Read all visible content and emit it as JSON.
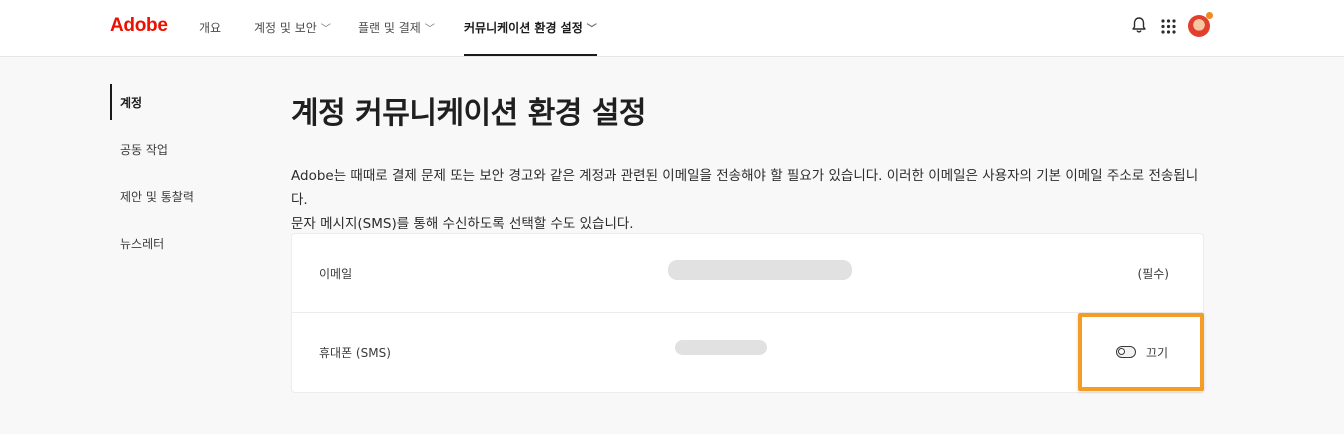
{
  "header": {
    "logo": "Adobe",
    "nav": [
      {
        "label": "개요"
      },
      {
        "label": "계정 및 보안"
      },
      {
        "label": "플랜 및 결제"
      },
      {
        "label": "커뮤니케이션 환경 설정"
      }
    ],
    "icons": [
      "bell-icon",
      "app-grid-icon",
      "avatar"
    ]
  },
  "sidebar": {
    "items": [
      {
        "label": "계정"
      },
      {
        "label": "공동 작업"
      },
      {
        "label": "제안 및 통찰력"
      },
      {
        "label": "뉴스레터"
      }
    ]
  },
  "main": {
    "title": "계정 커뮤니케이션 환경 설정",
    "description_line1": "Adobe는 때때로 결제 문제 또는 보안 경고와 같은 계정과 관련된 이메일을 전송해야 할 필요가 있습니다. 이러한 이메일은 사용자의 기본 이메일 주소로 전송됩니다.",
    "description_line2": "문자 메시지(SMS)를 통해 수신하도록 선택할 수도 있습니다.",
    "rows": [
      {
        "label": "이메일",
        "status": "(필수)"
      },
      {
        "label": "휴대폰 (SMS)",
        "toggle_label": "끄기",
        "toggle_on": false
      }
    ]
  },
  "colors": {
    "brand": "#eb1000",
    "highlight": "#f39c26"
  }
}
